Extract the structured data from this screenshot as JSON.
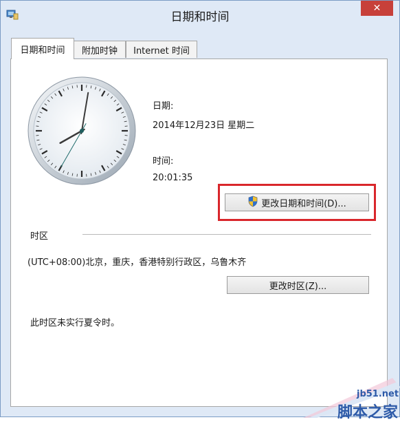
{
  "window": {
    "title": "日期和时间",
    "close_glyph": "✕"
  },
  "tabs": [
    {
      "label": "日期和时间",
      "active": true
    },
    {
      "label": "附加时钟",
      "active": false
    },
    {
      "label": "Internet 时间",
      "active": false
    }
  ],
  "datetime": {
    "date_label": "日期:",
    "date_value": "2014年12月23日 星期二",
    "time_label": "时间:",
    "time_value": "20:01:35",
    "clock_time": {
      "hour": 20,
      "minute": 1,
      "second": 35
    },
    "change_button_label": "更改日期和时间(D)...",
    "change_button_icon": "uac-shield-icon",
    "highlight_color": "#d9262b"
  },
  "timezone": {
    "section_label": "时区",
    "value": "(UTC+08:00)北京，重庆，香港特别行政区，乌鲁木齐",
    "change_button_label": "更改时区(Z)...",
    "dst_note": "此时区未实行夏令时。"
  },
  "watermark": {
    "url": "jb51.net",
    "name": "脚本之家"
  },
  "colors": {
    "titlebar": "#dfe9f6",
    "close_button": "#c7403a",
    "panel": "#ffffff",
    "watermark_blue": "#2d5aa8"
  }
}
